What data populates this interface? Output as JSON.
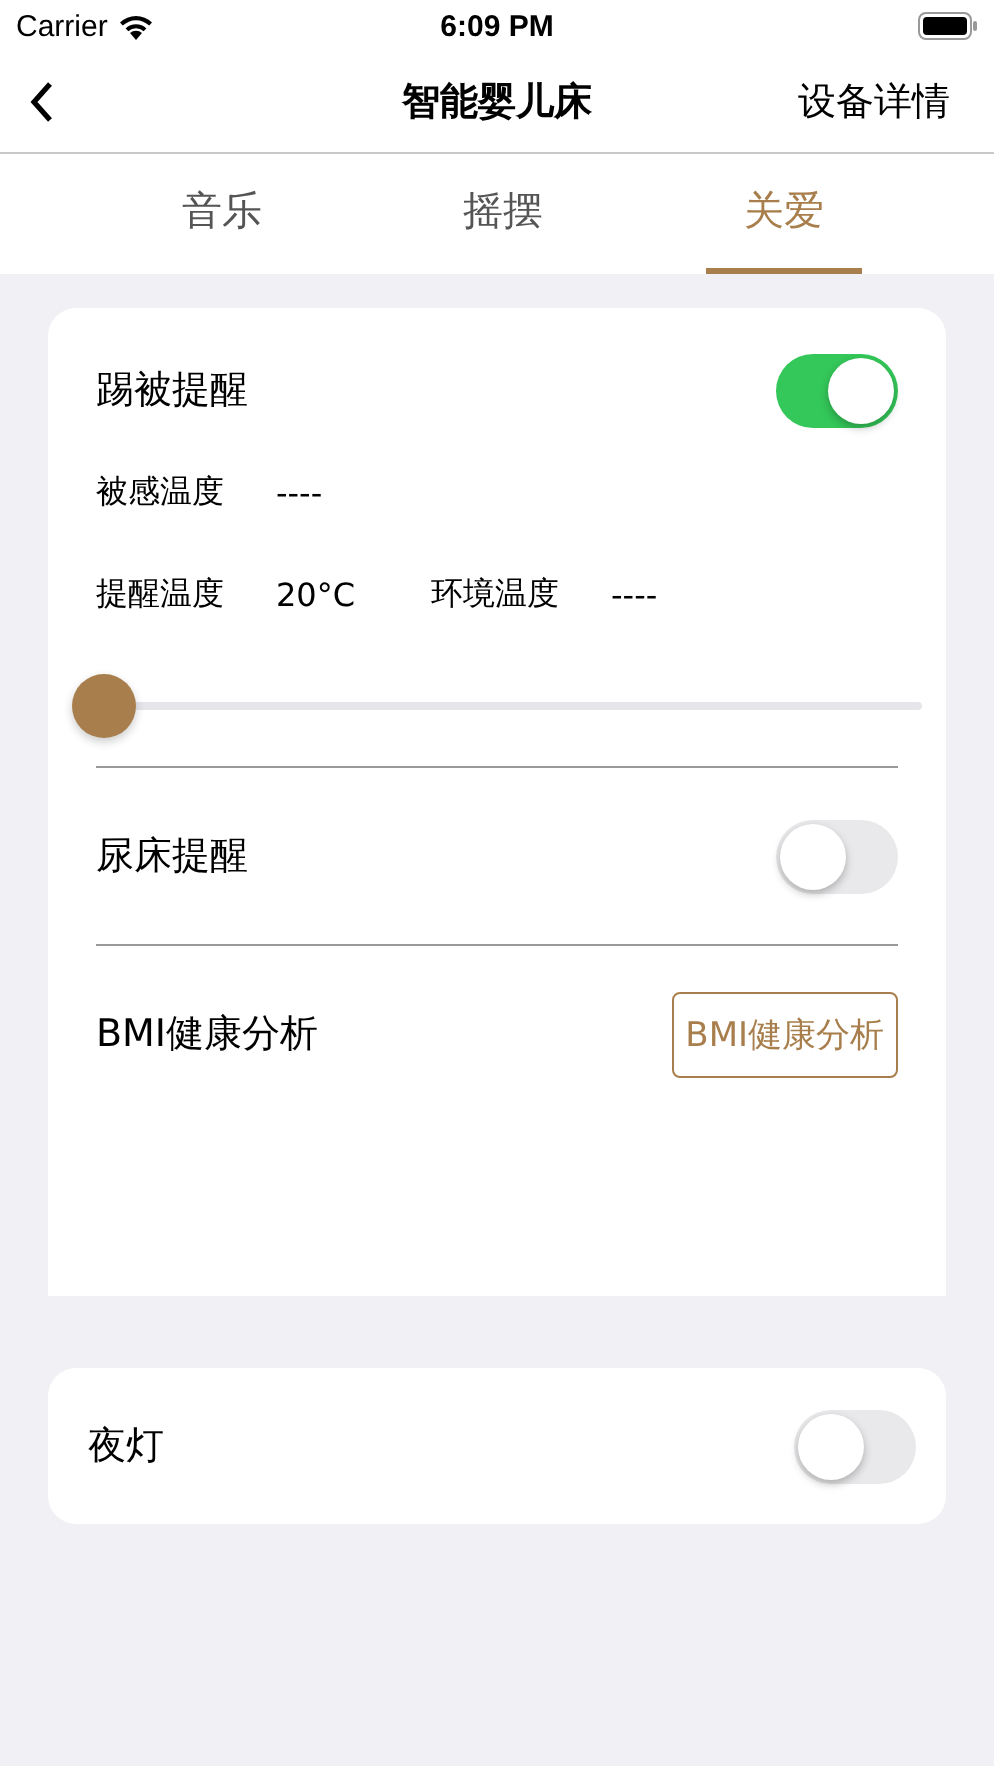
{
  "status_bar": {
    "carrier": "Carrier",
    "time": "6:09 PM"
  },
  "nav": {
    "title": "智能婴儿床",
    "action": "设备详情"
  },
  "tabs": [
    {
      "label": "音乐",
      "selected": false
    },
    {
      "label": "摇摆",
      "selected": false
    },
    {
      "label": "关爱",
      "selected": true
    }
  ],
  "kick_reminder": {
    "label": "踢被提醒",
    "on": true,
    "quilt_temp": {
      "label": "被感温度",
      "value": "----"
    },
    "alert_temp": {
      "label": "提醒温度",
      "value": "20°C"
    },
    "env_temp": {
      "label": "环境温度",
      "value": "----"
    },
    "slider": {
      "level": 0
    }
  },
  "bedwetting": {
    "label": "尿床提醒",
    "on": false
  },
  "bmi": {
    "label": "BMI健康分析",
    "button": "BMI健康分析"
  },
  "night_light": {
    "label": "夜灯",
    "on": false
  }
}
